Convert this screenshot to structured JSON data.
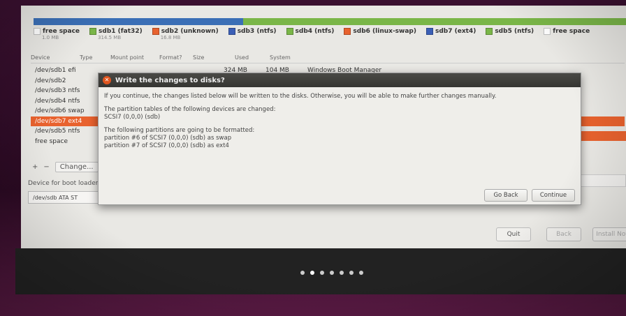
{
  "partition_bar": [
    {
      "color": "#3b6fb6",
      "flex": 300
    },
    {
      "color": "#7ab648",
      "flex": 548
    }
  ],
  "legend": [
    {
      "label": "free space",
      "size": "1.0 MB",
      "color": "#ffffff"
    },
    {
      "label": "sdb1 (fat32)",
      "size": "314.5 MB",
      "color": "#7ab648"
    },
    {
      "label": "sdb2 (unknown)",
      "size": "16.8 MB",
      "color": "#e8622e"
    },
    {
      "label": "sdb3 (ntfs)",
      "size": "",
      "color": "#3b5fb6"
    },
    {
      "label": "sdb4 (ntfs)",
      "size": "",
      "color": "#7ab648"
    },
    {
      "label": "sdb6 (linux-swap)",
      "size": "",
      "color": "#e8622e"
    },
    {
      "label": "sdb7 (ext4)",
      "size": "",
      "color": "#3b5fb6"
    },
    {
      "label": "sdb5 (ntfs)",
      "size": "",
      "color": "#7ab648"
    },
    {
      "label": "free space",
      "size": "",
      "color": "#ffffff"
    }
  ],
  "table": {
    "headers": [
      "Device",
      "Type",
      "Mount point",
      "Format?",
      "Size",
      "Used",
      "System"
    ],
    "rows": [
      {
        "device": "/dev/sdb1 efi",
        "size": "324 MB",
        "used": "104 MB",
        "system": "Windows Boot Manager",
        "selected": false
      },
      {
        "device": "/dev/sdb2",
        "size": "",
        "used": "",
        "system": "",
        "selected": false
      },
      {
        "device": "/dev/sdb3 ntfs",
        "size": "",
        "used": "",
        "system": "",
        "selected": false
      },
      {
        "device": "/dev/sdb4 ntfs",
        "size": "",
        "used": "",
        "system": "",
        "selected": false
      },
      {
        "device": "/dev/sdb6 swap",
        "size": "",
        "used": "",
        "system": "",
        "selected": false
      },
      {
        "device": "/dev/sdb7 ext4",
        "size": "",
        "used": "",
        "system": "",
        "selected": true
      },
      {
        "device": "/dev/sdb5 ntfs",
        "size": "",
        "used": "",
        "system": "",
        "selected": false
      },
      {
        "device": "free space",
        "size": "",
        "used": "",
        "system": "",
        "selected": false
      }
    ]
  },
  "tools": {
    "add": "+",
    "remove": "−",
    "change": "Change..."
  },
  "boot": {
    "label": "Device for boot loader installation:",
    "value": "/dev/sdb ATA ST"
  },
  "nav": {
    "quit": "Quit",
    "back": "Back",
    "install": "Install Now"
  },
  "dialog": {
    "title": "Write the changes to disks?",
    "intro": "If you continue, the changes listed below will be written to the disks. Otherwise, you will be able to make further changes manually.",
    "tables_heading": "The partition tables of the following devices are changed:",
    "tables_device": "SCSI7 (0,0,0) (sdb)",
    "format_heading": "The following partitions are going to be formatted:",
    "format_1": "partition #6 of SCSI7 (0,0,0) (sdb) as swap",
    "format_2": "partition #7 of SCSI7 (0,0,0) (sdb) as ext4",
    "go_back": "Go Back",
    "continue": "Continue"
  },
  "progress_dots": {
    "total": 7,
    "current": 1
  }
}
